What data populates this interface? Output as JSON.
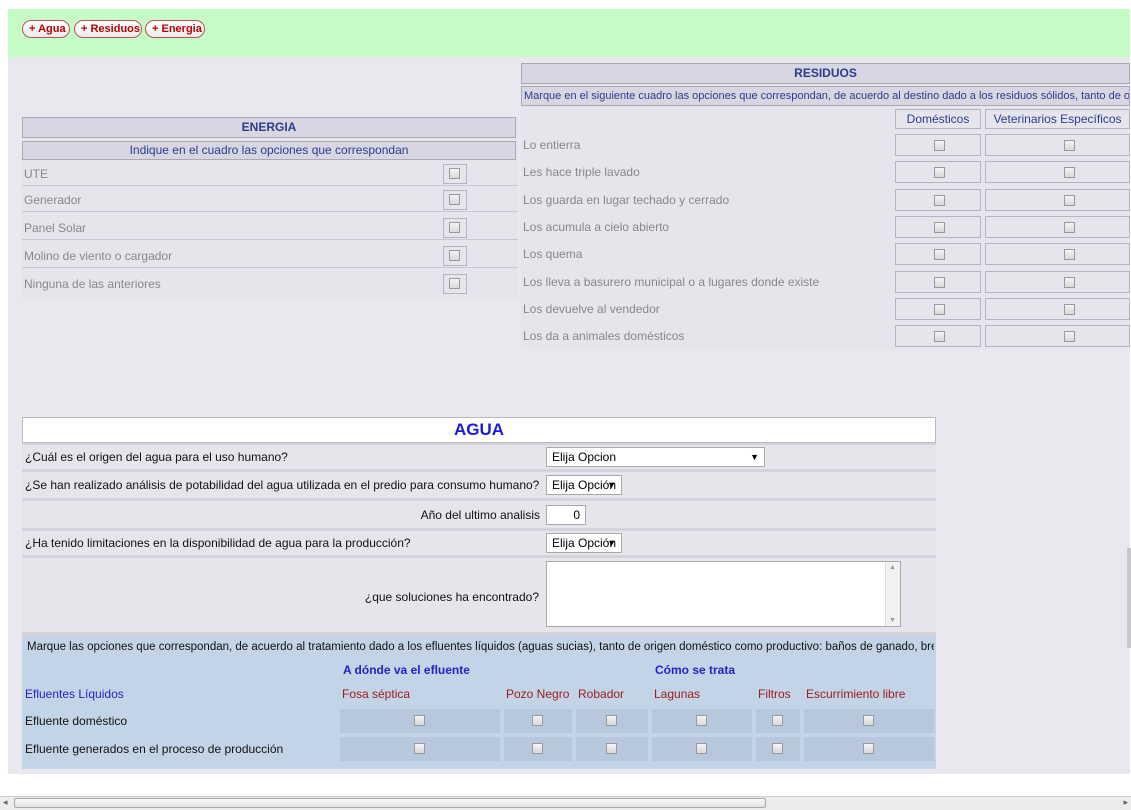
{
  "toolbar": {
    "buttons": [
      "Agua",
      "Residuos",
      "Energia"
    ]
  },
  "energia": {
    "title": "ENERGIA",
    "instruction": "Indique en el cuadro las opciones que correspondan",
    "options": [
      "UTE",
      "Generador",
      "Panel Solar",
      "Molino de viento o cargador",
      "Ninguna de las anteriores"
    ]
  },
  "residuos": {
    "title": "RESIDUOS",
    "instruction": "Marque en el siguiente cuadro las opciones que correspondan, de acuerdo al destino dado a los residuos sólidos, tanto de origen d",
    "col1": "Domésticos",
    "col2": "Veterinarios Específicos",
    "options": [
      "Lo entierra",
      "Les hace triple lavado",
      "Los guarda en lugar techado y cerrado",
      "Los acumula a cielo abierto",
      "Los quema",
      "Los lleva a basurero municipal o a lugares donde existe",
      "Los devuelve al vendedor",
      "Los da a animales domésticos"
    ]
  },
  "agua": {
    "title": "AGUA",
    "q_origen": "¿Cuál es el origen del agua para el uso humano?",
    "sel_origen": "Elija Opcion",
    "q_analisis": "¿Se han realizado análisis de potabilidad del agua utilizada en el predio para consumo humano?",
    "sel_analisis": "Elija Opción",
    "q_anio": "Año del ultimo analisis",
    "anio_value": "0",
    "q_limitaciones": "¿Ha tenido limitaciones en la disponibilidad de agua para la producción?",
    "sel_limitaciones": "Elija Opción",
    "q_soluciones": "¿que soluciones ha encontrado?",
    "soluciones_value": "",
    "efluentes": {
      "instruction": "Marque las opciones que correspondan, de acuerdo al tratamiento dado a los efluentes líquidos (aguas sucias), tanto de origen doméstico como productivo: baños de ganado, bretes, etc.",
      "group1": "A dónde va el efluente",
      "group2": "Cómo se trata",
      "row_header": "Efluentes Líquidos",
      "columns": [
        "Fosa séptica",
        "Pozo Negro",
        "Robador",
        "Lagunas",
        "Filtros",
        "Escurrimiento libre"
      ],
      "rows": [
        "Efluente doméstico",
        "Efluente generados en el proceso de producción"
      ]
    }
  }
}
